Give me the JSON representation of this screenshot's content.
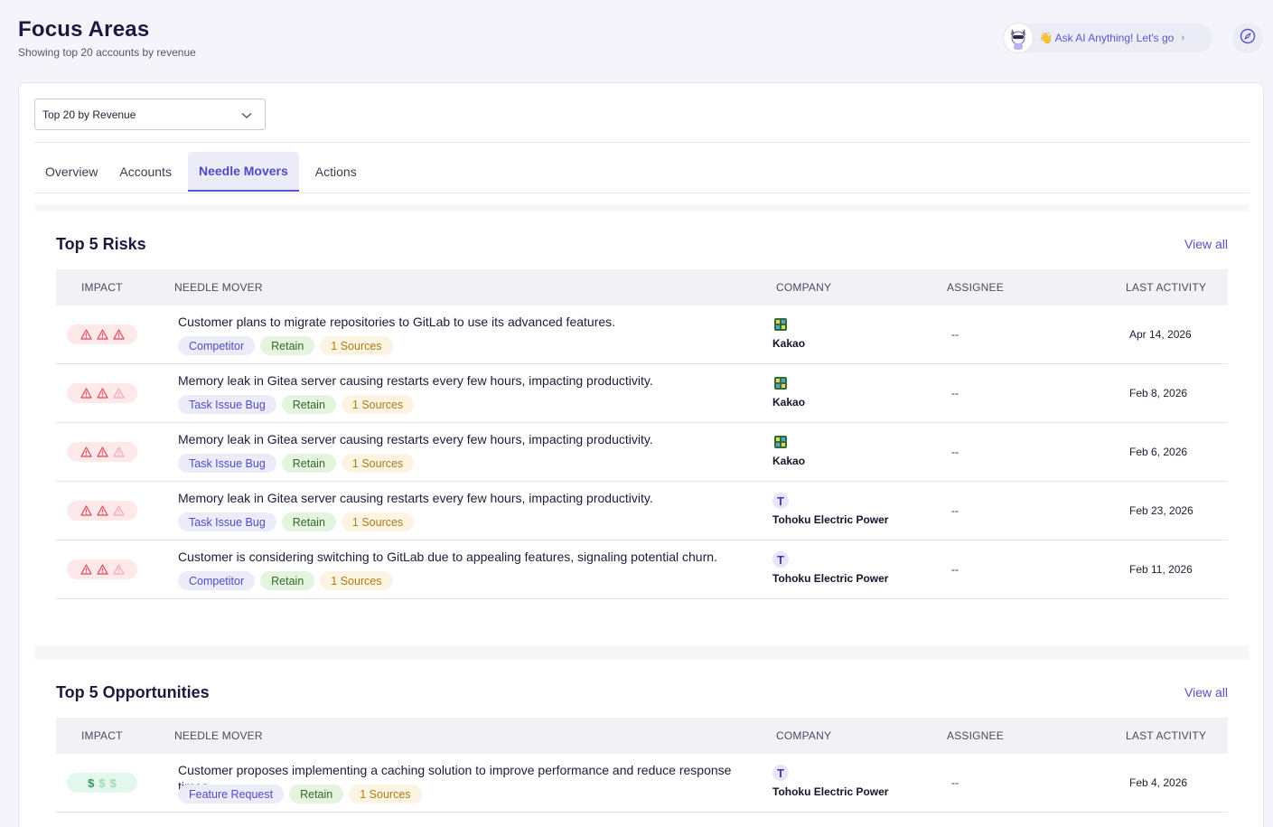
{
  "header": {
    "title": "Focus Areas",
    "subtitle": "Showing top 20 accounts by revenue",
    "ai_prompt": "👋 Ask AI Anything! Let's go"
  },
  "filter": {
    "selected": "Top 20 by Revenue"
  },
  "tabs": [
    {
      "label": "Overview",
      "active": false
    },
    {
      "label": "Accounts",
      "active": false
    },
    {
      "label": "Needle Movers",
      "active": true
    },
    {
      "label": "Actions",
      "active": false
    }
  ],
  "columns": {
    "impact": "IMPACT",
    "needle_mover": "NEEDLE MOVER",
    "company": "COMPANY",
    "assignee": "ASSIGNEE",
    "last_activity": "LAST ACTIVITY"
  },
  "risks": {
    "title": "Top 5 Risks",
    "view_all": "View all",
    "rows": [
      {
        "impact_level": 3,
        "title": "Customer plans to migrate repositories to GitLab to use its advanced features.",
        "type": "Competitor",
        "retain": "Retain",
        "sources": "1 Sources",
        "company": "Kakao",
        "company_icon": "kakao-logo-icon",
        "assignee": "--",
        "last_activity": "Apr 14, 2026"
      },
      {
        "impact_level": 2,
        "title": "Memory leak in Gitea server causing restarts every few hours, impacting productivity.",
        "type": "Task Issue Bug",
        "retain": "Retain",
        "sources": "1 Sources",
        "company": "Kakao",
        "company_icon": "kakao-logo-icon",
        "assignee": "--",
        "last_activity": "Feb 8, 2026"
      },
      {
        "impact_level": 2,
        "title": "Memory leak in Gitea server causing restarts every few hours, impacting productivity.",
        "type": "Task Issue Bug",
        "retain": "Retain",
        "sources": "1 Sources",
        "company": "Kakao",
        "company_icon": "kakao-logo-icon",
        "assignee": "--",
        "last_activity": "Feb 6, 2026"
      },
      {
        "impact_level": 2,
        "title": "Memory leak in Gitea server causing restarts every few hours, impacting productivity.",
        "type": "Task Issue Bug",
        "retain": "Retain",
        "sources": "1 Sources",
        "company": "Tohoku Electric Power",
        "company_initial": "T",
        "company_icon": "company-initial-icon",
        "assignee": "--",
        "last_activity": "Feb 23, 2026"
      },
      {
        "impact_level": 2,
        "title": "Customer is considering switching to GitLab due to appealing features, signaling potential churn.",
        "type": "Competitor",
        "retain": "Retain",
        "sources": "1 Sources",
        "company": "Tohoku Electric Power",
        "company_initial": "T",
        "company_icon": "company-initial-icon",
        "assignee": "--",
        "last_activity": "Feb 11, 2026"
      }
    ]
  },
  "opportunities": {
    "title": "Top 5 Opportunities",
    "view_all": "View all",
    "rows": [
      {
        "impact_level": 1,
        "title": "Customer proposes implementing a caching solution to improve performance and reduce response times.",
        "type": "Feature Request",
        "retain": "Retain",
        "sources": "1 Sources",
        "company": "Tohoku Electric Power",
        "company_initial": "T",
        "company_icon": "company-initial-icon",
        "assignee": "--",
        "last_activity": "Feb 4, 2026"
      }
    ]
  },
  "colors": {
    "accent": "#5650c8",
    "risk_strong": "#e0455a",
    "risk_faint": "#f2a9b3",
    "opp_strong": "#2a9a5c",
    "opp_faint": "#9fd9b8"
  }
}
